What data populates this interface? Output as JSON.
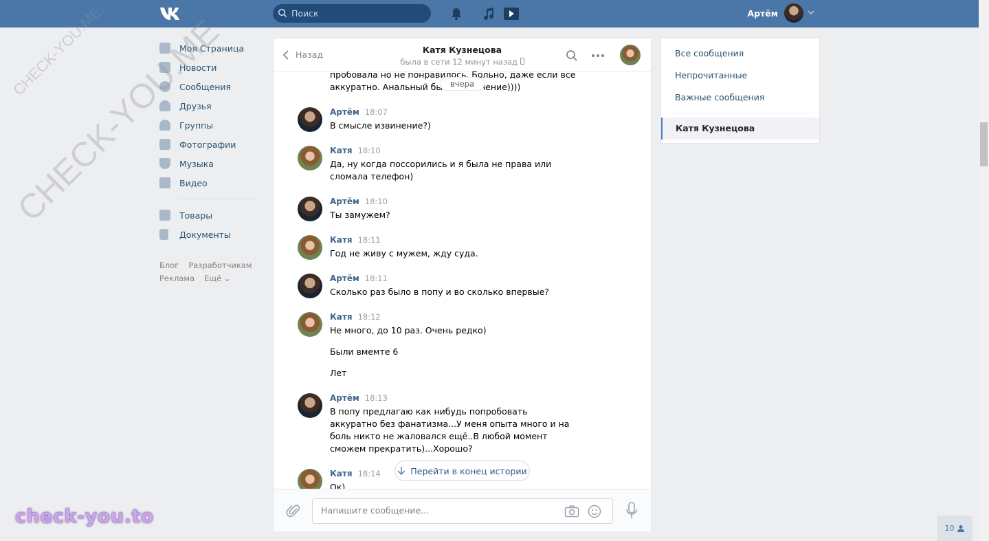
{
  "header": {
    "search_placeholder": "Поиск",
    "user_name": "Артём",
    "colors": {
      "bar": "#4a76a8",
      "search": "#224b7a"
    }
  },
  "left_menu": {
    "items": [
      {
        "label": "Моя Страница",
        "icon": "home-icon"
      },
      {
        "label": "Новости",
        "icon": "news-icon"
      },
      {
        "label": "Сообщения",
        "icon": "messages-icon"
      },
      {
        "label": "Друзья",
        "icon": "friends-icon"
      },
      {
        "label": "Группы",
        "icon": "groups-icon"
      },
      {
        "label": "Фотографии",
        "icon": "camera-icon"
      },
      {
        "label": "Музыка",
        "icon": "music-icon"
      },
      {
        "label": "Видео",
        "icon": "video-icon"
      }
    ],
    "items2": [
      {
        "label": "Товары",
        "icon": "bag-icon"
      },
      {
        "label": "Документы",
        "icon": "document-icon"
      }
    ],
    "footer": {
      "blog": "Блог",
      "devs": "Разработчикам",
      "ads": "Реклама",
      "more": "Ещё ⌄"
    }
  },
  "chat": {
    "back_label": "Назад",
    "title": "Катя Кузнецова",
    "status": "была в сети 12 минут назад",
    "date_pill": "вчера",
    "first_text": "пробовала но не понравилось. Больно, даже если все аккуратно. Анальный был                   к извинение))))",
    "messages": [
      {
        "author": "Артём",
        "time": "18:07",
        "kind": "artem",
        "text": "В смысле извинение?)"
      },
      {
        "author": "Катя",
        "time": "18:10",
        "kind": "katya",
        "text": "Да, ну когда поссорились и я была не права или сломала телефон)"
      },
      {
        "author": "Артём",
        "time": "18:10",
        "kind": "artem",
        "text": "Ты замужем?"
      },
      {
        "author": "Катя",
        "time": "18:11",
        "kind": "katya",
        "text": "Год не живу с мужем, жду суда."
      },
      {
        "author": "Артём",
        "time": "18:11",
        "kind": "artem",
        "text": "Сколько раз было в попу и во сколько впервые?"
      },
      {
        "author": "Катя",
        "time": "18:12",
        "kind": "katya",
        "text": "Не много, до 10 раз. Очень редко)"
      },
      {
        "author": "Артём",
        "time": "18:13",
        "kind": "artem",
        "text": "В попу предлагаю как нибудь попробовать аккуратно без фанатизма...У меня опыта много и на боль никто не жаловался ещё..В любой момент сможем прекратить)...Хорошо?"
      },
      {
        "author": "Катя",
        "time": "18:14",
        "kind": "katya",
        "text": "Ок)"
      }
    ],
    "followups": [
      "Были вмемте 6",
      "Лет"
    ],
    "goto_end": "Перейти в конец истории",
    "composer_placeholder": "Напишите сообщение..."
  },
  "right_menu": {
    "all": "Все сообщения",
    "unread": "Непрочитанные",
    "important": "Важные сообщения",
    "active": "Катя Кузнецова"
  },
  "watermark": "check-you.to",
  "diagonal_watermark": "CHECK-YOU.ME",
  "counter": "10"
}
